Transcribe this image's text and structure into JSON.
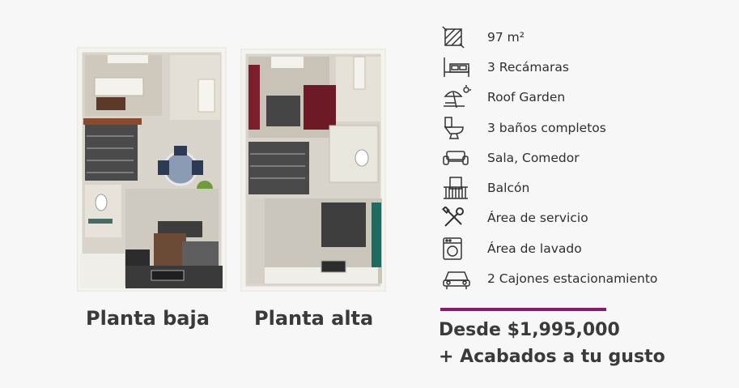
{
  "plans": {
    "ground_floor_title": "Planta baja",
    "upper_floor_title": "Planta alta"
  },
  "features": [
    {
      "icon": "area-icon",
      "label": "97 m²"
    },
    {
      "icon": "bed-icon",
      "label": "3 Recámaras"
    },
    {
      "icon": "umbrella-sun-icon",
      "label": "Roof Garden"
    },
    {
      "icon": "toilet-icon",
      "label": "3 baños completos"
    },
    {
      "icon": "sofa-icon",
      "label": "Sala, Comedor"
    },
    {
      "icon": "balcony-icon",
      "label": "Balcón"
    },
    {
      "icon": "tools-icon",
      "label": "Área de servicio"
    },
    {
      "icon": "washing-machine-icon",
      "label": "Área de lavado"
    },
    {
      "icon": "car-icon",
      "label": "2 Cajones estacionamiento"
    }
  ],
  "pricing": {
    "price": "Desde $1,995,000",
    "extras": "+ Acabados a tu gusto"
  },
  "colors": {
    "accent": "#8b1a6e",
    "wall": "#f1efe8",
    "floor": "#d9d5cc",
    "dark_floor": "#5a5a5a",
    "burgundy": "#7a1f2b",
    "teal": "#1e6b60"
  }
}
